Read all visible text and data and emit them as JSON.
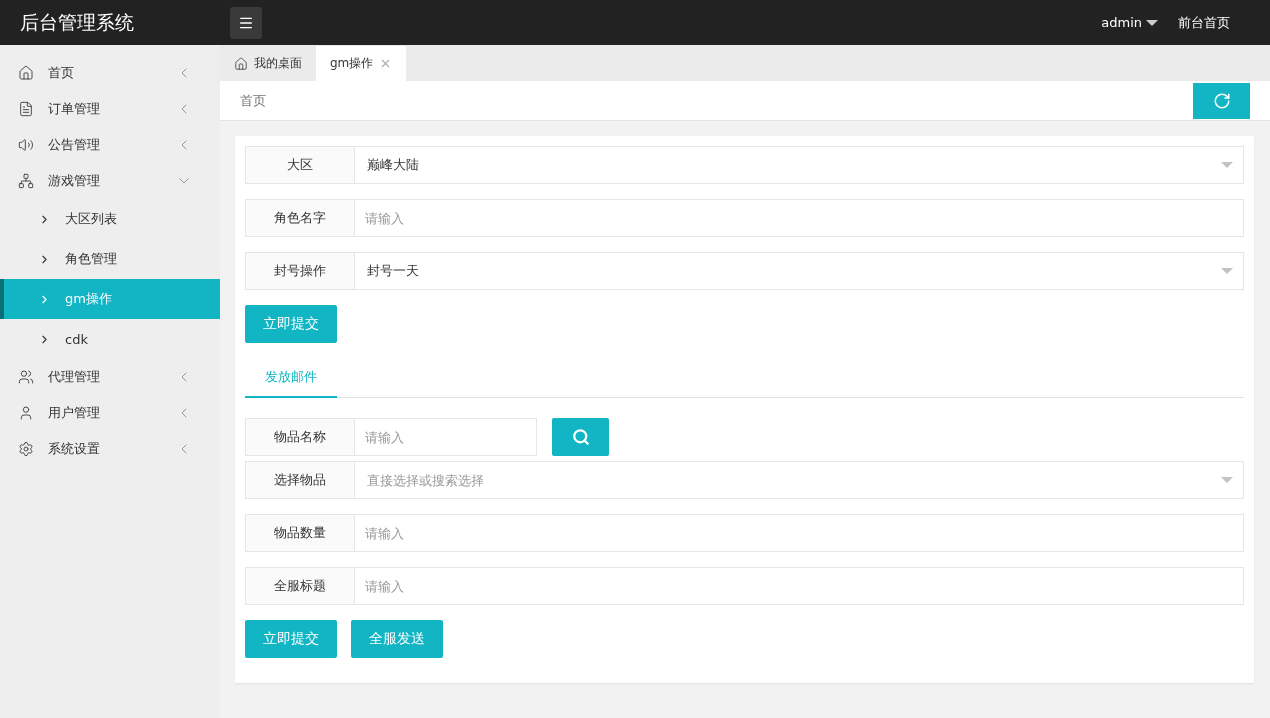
{
  "header": {
    "title": "后台管理系统",
    "user": "admin",
    "links": [
      "前台首页"
    ]
  },
  "sidebar": {
    "items": [
      {
        "label": "首页",
        "expanded": false
      },
      {
        "label": "订单管理",
        "expanded": false
      },
      {
        "label": "公告管理",
        "expanded": false
      },
      {
        "label": "游戏管理",
        "expanded": true,
        "children": [
          {
            "label": "大区列表",
            "selected": false
          },
          {
            "label": "角色管理",
            "selected": false
          },
          {
            "label": "gm操作",
            "selected": true
          },
          {
            "label": "cdk",
            "selected": false
          }
        ]
      },
      {
        "label": "代理管理",
        "expanded": false
      },
      {
        "label": "用户管理",
        "expanded": false
      },
      {
        "label": "系统设置",
        "expanded": false
      }
    ]
  },
  "tabs": [
    {
      "label": "我的桌面",
      "kind": "home",
      "selected": false
    },
    {
      "label": "gm操作",
      "kind": "closable",
      "selected": true
    }
  ],
  "breadcrumb": "首页",
  "ban_form": {
    "fields": [
      {
        "label": "大区",
        "kind": "select",
        "value": "巅峰大陆"
      },
      {
        "label": "角色名字",
        "kind": "input",
        "placeholder": "请输入"
      },
      {
        "label": "封号操作",
        "kind": "select",
        "value": "封号一天"
      }
    ],
    "buttons": [
      "立即提交"
    ]
  },
  "mail_tabs": [
    {
      "label": "发放邮件",
      "selected": true
    }
  ],
  "mail_form": {
    "fields": [
      {
        "label": "物品名称",
        "kind": "search",
        "placeholder": "请输入"
      },
      {
        "label": "选择物品",
        "kind": "select",
        "placeholder": "直接选择或搜索选择"
      },
      {
        "label": "物品数量",
        "kind": "input",
        "placeholder": "请输入"
      },
      {
        "label": "全服标题",
        "kind": "input",
        "placeholder": "请输入"
      }
    ],
    "buttons": [
      "立即提交",
      "全服发送"
    ]
  }
}
